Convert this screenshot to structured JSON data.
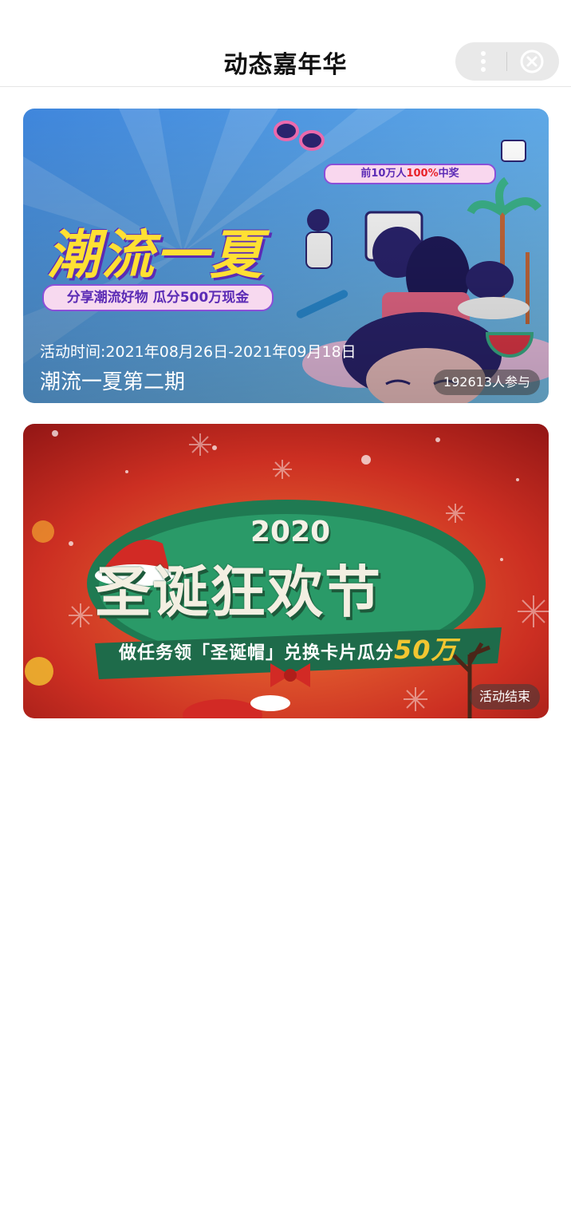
{
  "header": {
    "title": "动态嘉年华"
  },
  "capsule": {
    "more_icon": "more-vertical-icon",
    "close_icon": "close-circle-icon"
  },
  "activities": [
    {
      "banner_headline": "潮流一夏",
      "banner_subtitle": "分享潮流好物 瓜分500万现金",
      "banner_prize_prefix": "前10万人",
      "banner_prize_highlight": "100%",
      "banner_prize_suffix": "中奖",
      "date": "活动时间:2021年08月26日-2021年09月18日",
      "name": "潮流一夏第二期",
      "badge": "192613人参与",
      "colors": {
        "bg_top": "#4a90e2",
        "bg_bottom": "#6fc3f0"
      }
    },
    {
      "banner_year": "2020",
      "banner_headline": "圣诞狂欢节",
      "banner_subtitle_main": "做任务领「圣诞帽」兑换卡片瓜分",
      "banner_subtitle_amount": "50万",
      "badge": "活动结束",
      "colors": {
        "bg_top": "#b8201e",
        "bg_bottom": "#e85a2a"
      }
    }
  ]
}
